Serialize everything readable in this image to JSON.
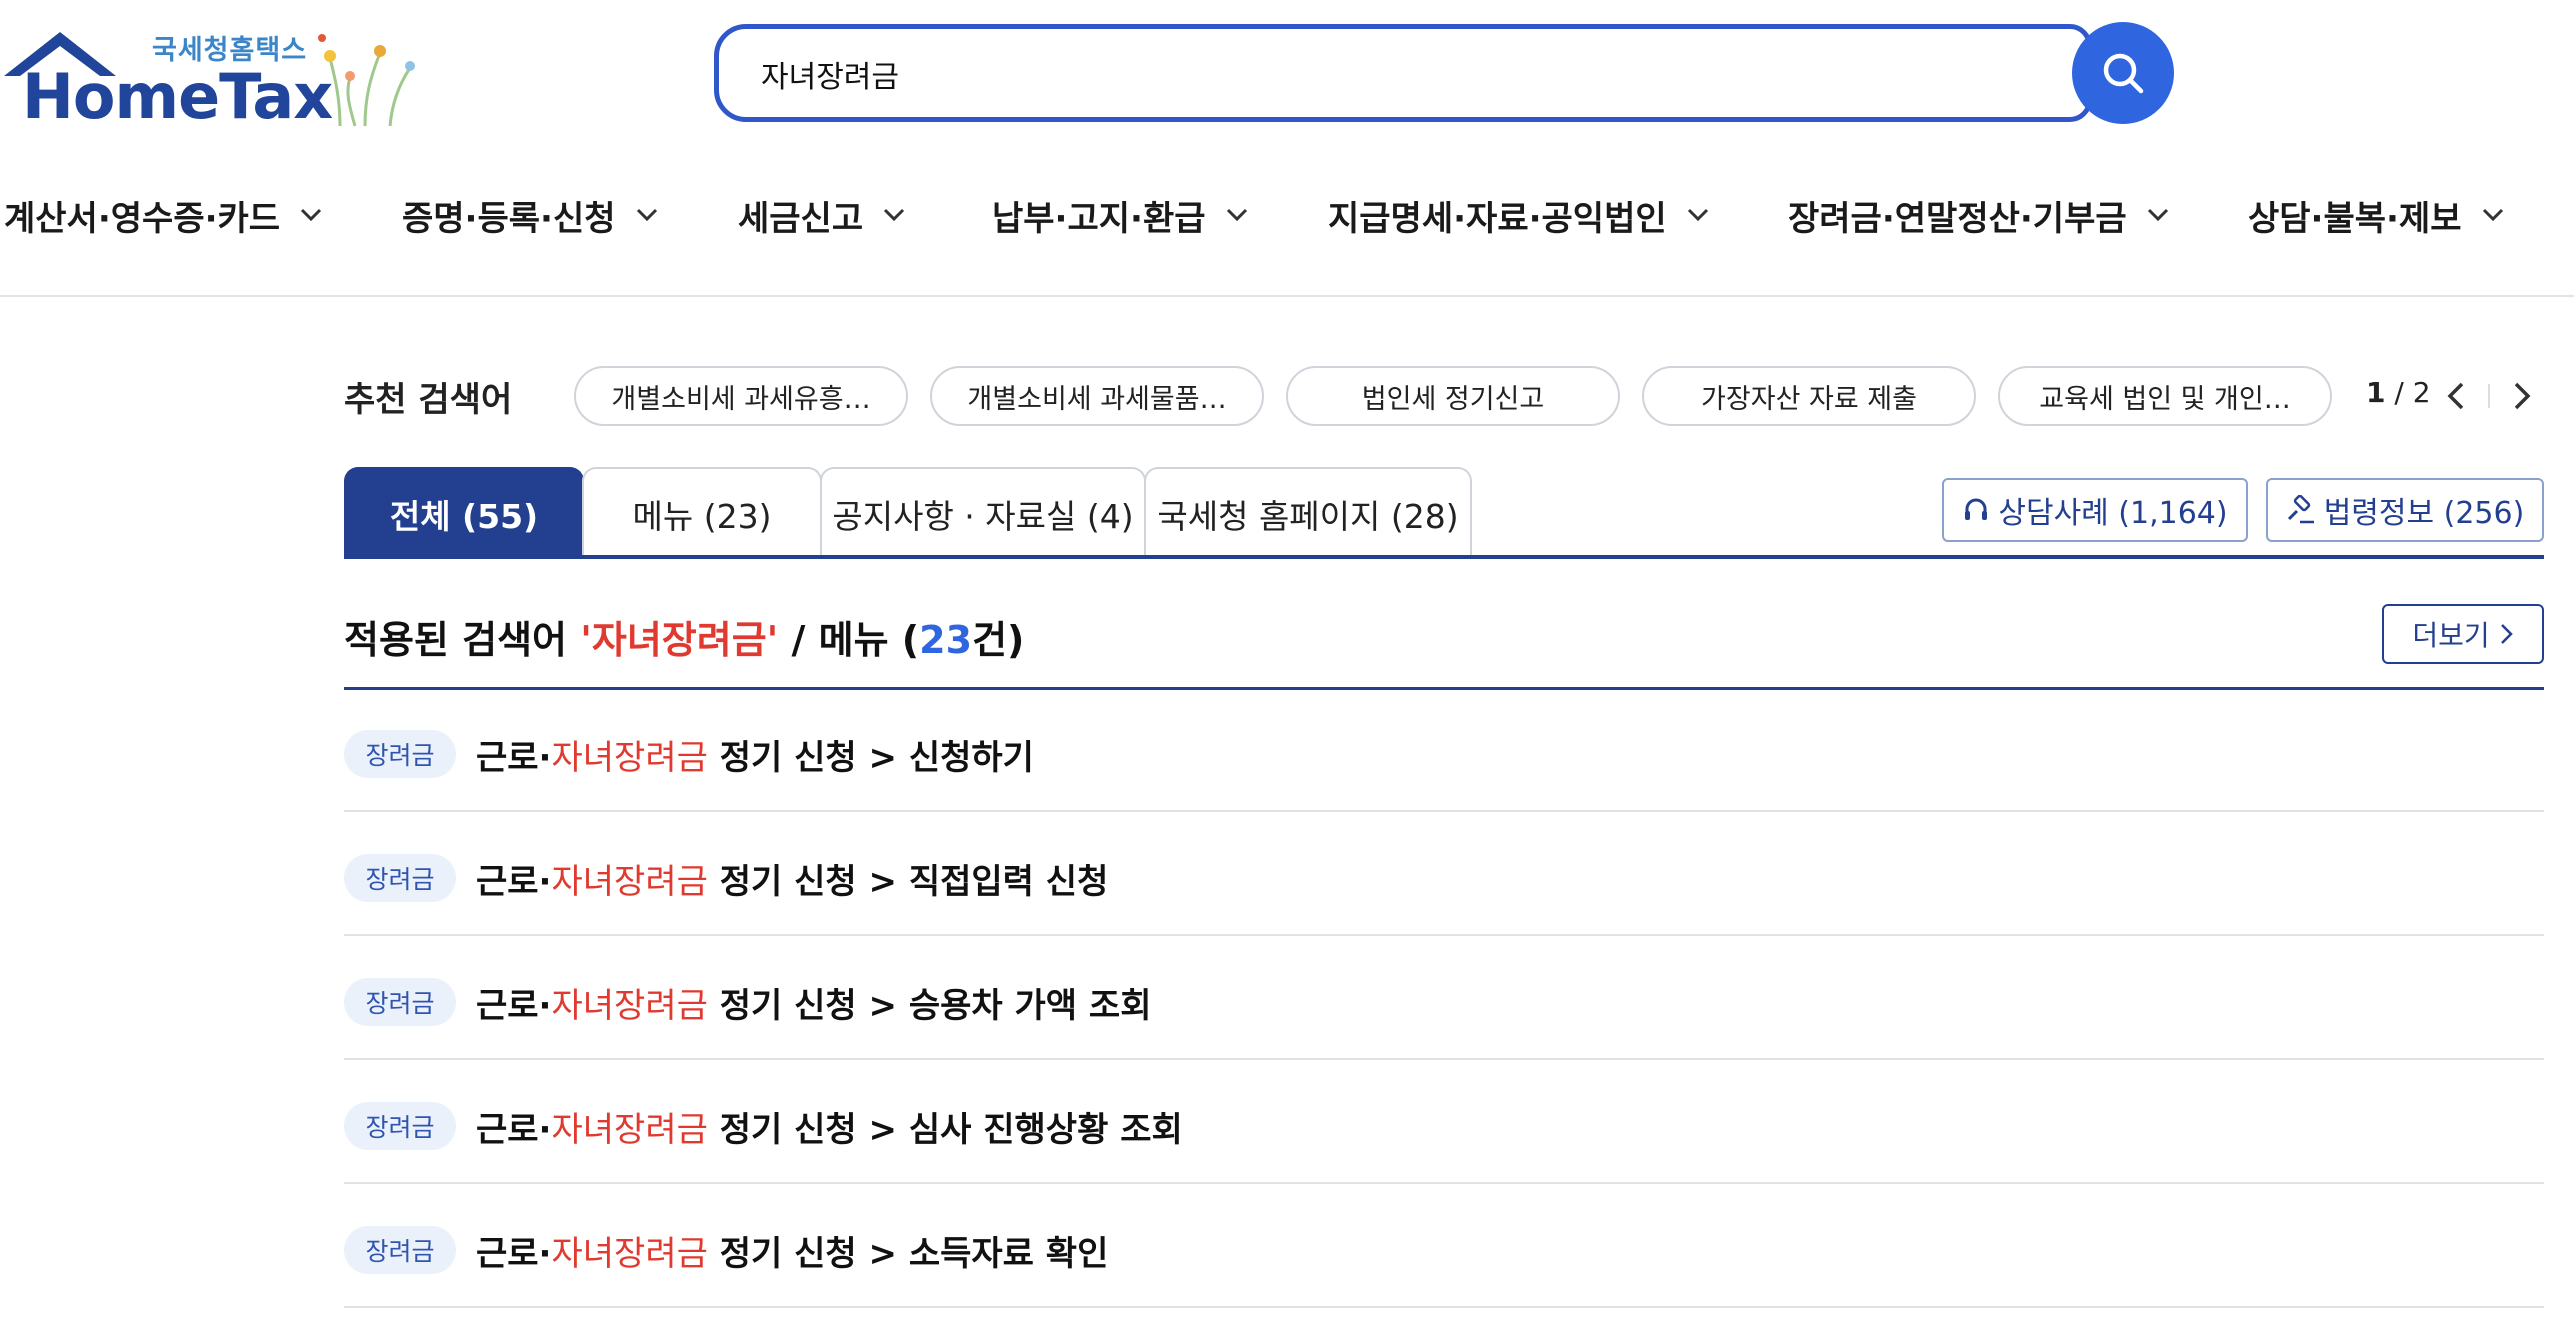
{
  "brand": {
    "sub": "국세청홈택스",
    "main": "HomeTax"
  },
  "search": {
    "value": "자녀장려금",
    "button_icon": "search-icon"
  },
  "gnb": [
    {
      "label": "계산서·영수증·카드"
    },
    {
      "label": "증명·등록·신청"
    },
    {
      "label": "세금신고"
    },
    {
      "label": "납부·고지·환급"
    },
    {
      "label": "지급명세·자료·공익법인"
    },
    {
      "label": "장려금·연말정산·기부금"
    },
    {
      "label": "상담·불복·제보"
    }
  ],
  "recommended": {
    "title": "추천 검색어",
    "chips": [
      "개별소비세 과세유흥…",
      "개별소비세 과세물품…",
      "법인세 정기신고",
      "가장자산 자료 제출",
      "교육세 법인 및 개인…"
    ],
    "page_current": "1",
    "page_total": "/ 2"
  },
  "tabs": [
    {
      "label": "전체 (55)",
      "active": true
    },
    {
      "label": "메뉴 (23)",
      "active": false
    },
    {
      "label": "공지사항 · 자료실 (4)",
      "active": false
    },
    {
      "label": "국세청 홈페이지 (28)",
      "active": false
    }
  ],
  "side_buttons": [
    {
      "label": "상담사례 (1,164)",
      "icon": "headset-icon"
    },
    {
      "label": "법령정보 (256)",
      "icon": "gavel-icon"
    }
  ],
  "result": {
    "prefix": "적용된 검색어 ",
    "keyword": "'자녀장려금'",
    "mid": " / 메뉴 (",
    "count": "23",
    "suffix": "건)",
    "more_label": "더보기"
  },
  "rows": [
    {
      "badge": "장려금",
      "pre": "근로·",
      "hl": "자녀장려금",
      "post": " 정기 신청 > 신청하기"
    },
    {
      "badge": "장려금",
      "pre": "근로·",
      "hl": "자녀장려금",
      "post": " 정기 신청 > 직접입력 신청"
    },
    {
      "badge": "장려금",
      "pre": "근로·",
      "hl": "자녀장려금",
      "post": " 정기 신청 > 승용차 가액 조회"
    },
    {
      "badge": "장려금",
      "pre": "근로·",
      "hl": "자녀장려금",
      "post": " 정기 신청 > 심사 진행상황 조회"
    },
    {
      "badge": "장려금",
      "pre": "근로·",
      "hl": "자녀장려금",
      "post": " 정기 신청 > 소득자료 확인"
    }
  ],
  "colors": {
    "primary": "#233f8f",
    "accent_blue": "#2f66e0",
    "highlight_red": "#e0392f"
  }
}
